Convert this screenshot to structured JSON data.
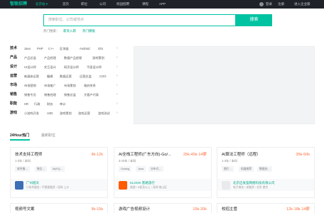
{
  "header": {
    "logo": "智联招聘",
    "city": "北京站 ▾",
    "nav": [
      "首页",
      "职位",
      "公司",
      "校园招聘",
      "课程",
      "APP"
    ],
    "user_links": [
      "登录",
      "注册",
      "进入企业版"
    ]
  },
  "search": {
    "placeholder": "搜索职位、公司或地点",
    "button_label": "搜索",
    "hot_label": "热门搜索：",
    "hot_items": [
      "薪资入职",
      "热门模板"
    ]
  },
  "categories": [
    {
      "title": "技术",
      "items": [
        "Java",
        "PHP",
        "C++",
        "区块链",
        "Android",
        "iOS"
      ]
    },
    {
      "title": "产品",
      "items": [
        "产品总监",
        "产品经理",
        "数据产品经理",
        "游戏策划"
      ]
    },
    {
      "title": "设计",
      "items": [
        "UI设计师",
        "交互设计",
        "网页设计师",
        "平面设计师"
      ]
    },
    {
      "title": "运营",
      "items": [
        "新媒体运营",
        "编辑",
        "数据运营",
        "运营总监",
        "COO"
      ]
    },
    {
      "title": "市场",
      "items": [
        "市场营销",
        "市场推广",
        "市场策划",
        "政府关系"
      ]
    },
    {
      "title": "销售",
      "items": [
        "销售专员",
        "销售经理",
        "销售总监",
        "大客户代表"
      ]
    },
    {
      "title": "职能",
      "items": [
        "HR",
        "行政",
        "财务",
        "审计"
      ]
    },
    {
      "title": "游戏",
      "items": [
        "小游戏开发",
        "U3D",
        "游戏策划",
        "游戏运营",
        "游戏测试"
      ]
    }
  ],
  "tabs": [
    "24Hour热门",
    "最新职位"
  ],
  "jobs": [
    {
      "title": "技术支持工程师",
      "salary": "9k-12k",
      "meta": "1-3年 / 本科",
      "tags": [
        "软件服...",
        "售后...",
        "MySQ..."
      ],
      "company": "广州旭天",
      "company_info": "IT技术服务 / 不需要融资 / 深圳 上沙",
      "logo_color": "#3b6fb6"
    },
    {
      "title": "AI全栈工程师(广东方向)-Go/...",
      "salary": "25k-45k·14薪",
      "meta": "3-10年 / 本科",
      "tags": [
        "Golang",
        "Java",
        "分布式..."
      ],
      "company": "KLOOK 客路旅行",
      "company_info": "旅游 / D轮及以上 / 深圳 南山区",
      "logo_color": "#ff5b00"
    },
    {
      "title": "AI算法工程师（远程）",
      "salary": "35k-50k",
      "meta": "1-3年 / 本科",
      "tags": [
        "图片...",
        "机器推荐",
        "数据处..."
      ],
      "company": "北京启发鉴网络科技有限公司",
      "company_info": "电子商务 / 未融资 / 北京 望京",
      "logo_color": "#e8eaed"
    }
  ],
  "jobs_row2": [
    {
      "title": "视频号文案",
      "salary": "9k-15k"
    },
    {
      "title": "游戏广告视频设计",
      "salary": "15k-20k"
    },
    {
      "title": "校招主管",
      "salary": "12k-18k·14薪"
    }
  ]
}
